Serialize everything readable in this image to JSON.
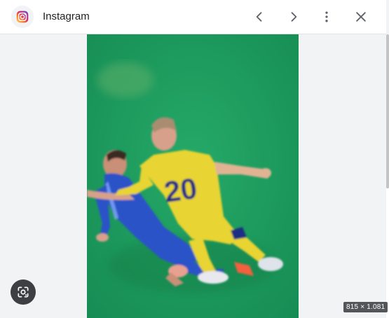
{
  "header": {
    "app_icon": "instagram-icon",
    "title": "Instagram",
    "buttons": {
      "previous": "chevron-left-icon",
      "next": "chevron-right-icon",
      "more": "more-vert-icon",
      "close": "close-icon"
    }
  },
  "viewer": {
    "image_dimensions": "815 × 1.081",
    "lens_icon": "google-lens-icon",
    "jersey_number": "20"
  },
  "colors": {
    "pitch": "#1c9a5c",
    "yellow_kit": "#e8d431",
    "blue_kit": "#2a52c8"
  }
}
